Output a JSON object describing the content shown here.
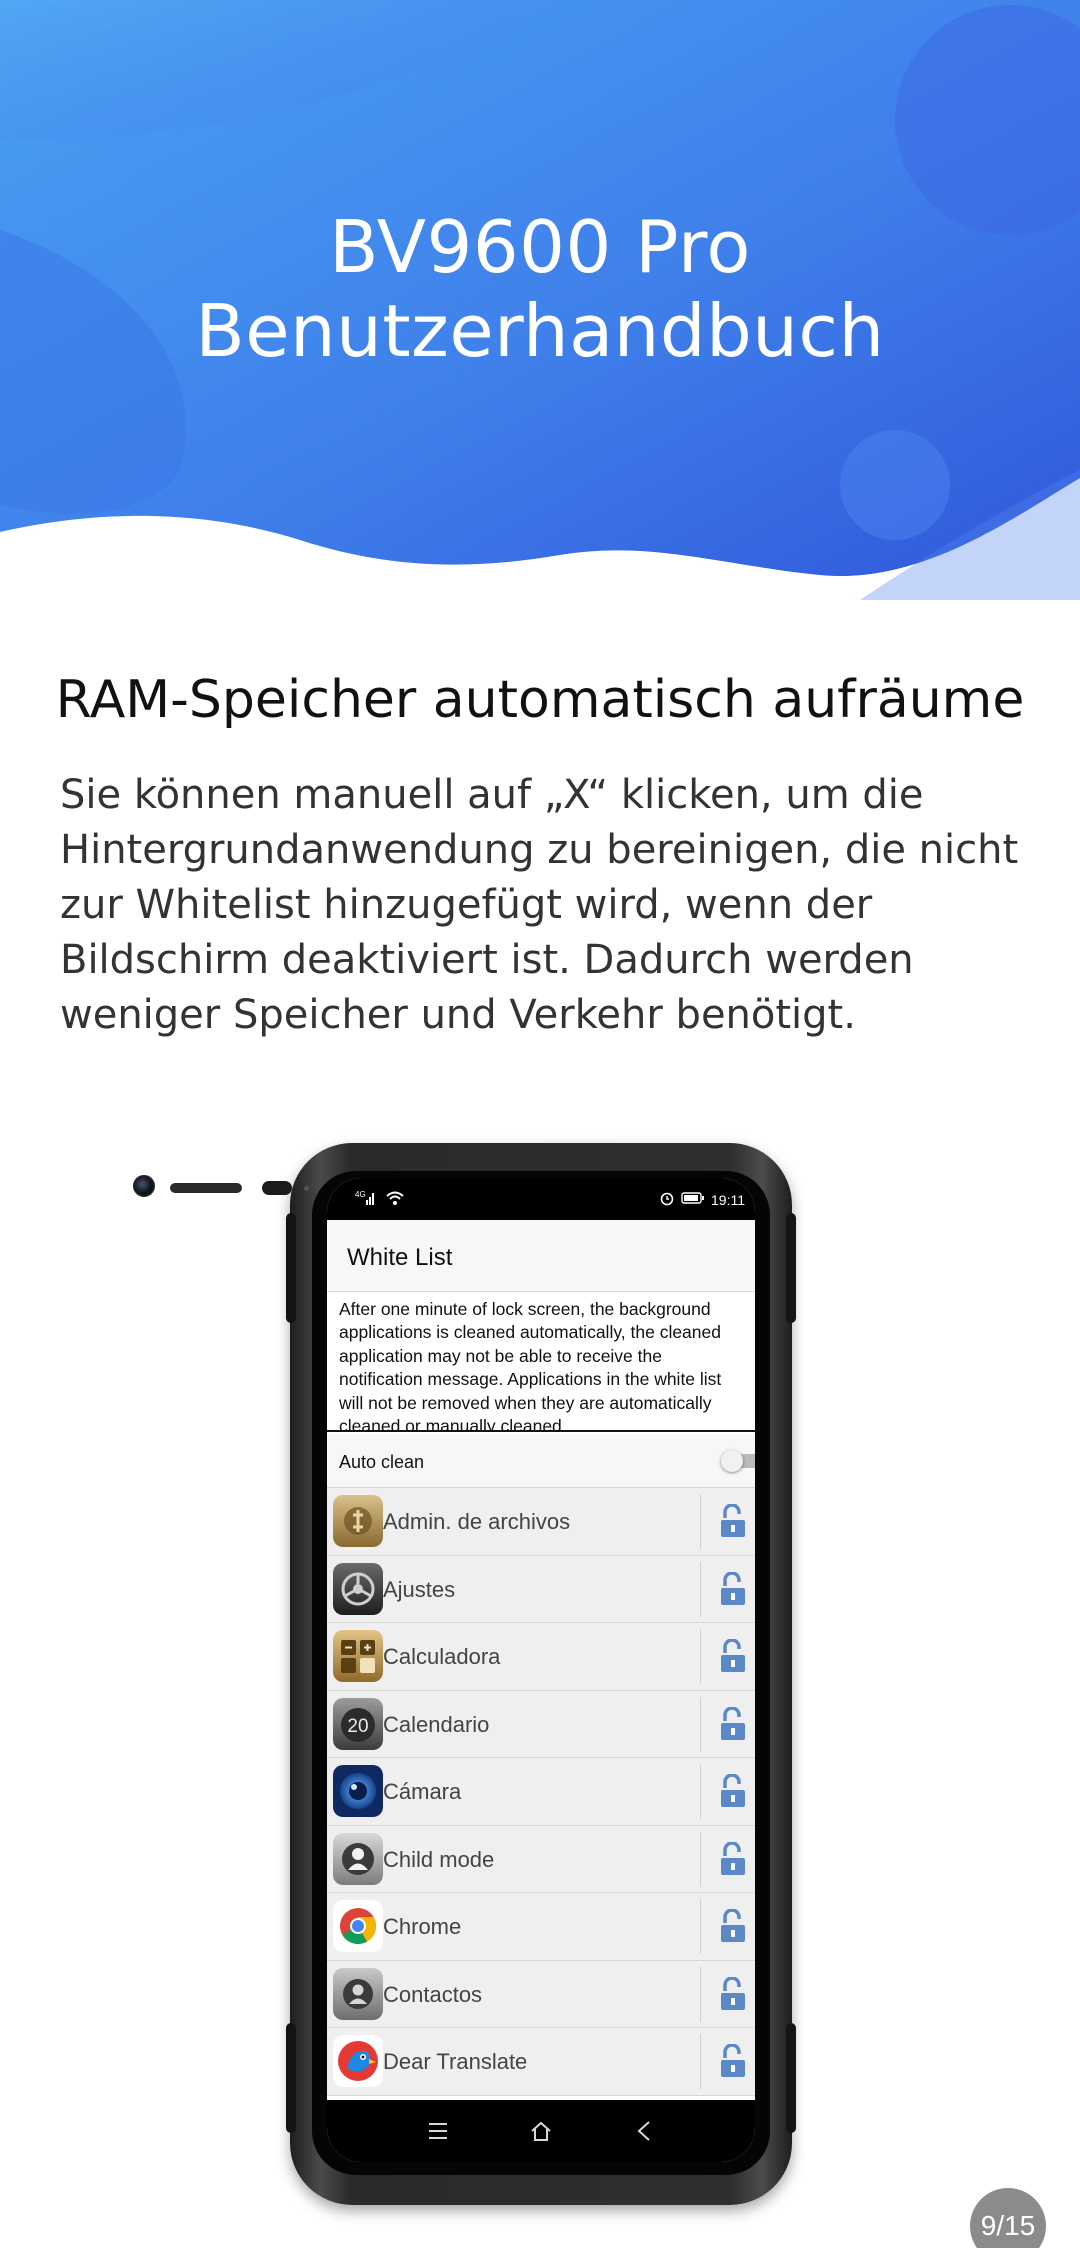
{
  "header": {
    "title": "BV9600 Pro Benutzerhandbuch",
    "colors": {
      "gradient_light": "#4a9af1",
      "gradient_dark": "#3462e2"
    }
  },
  "section": {
    "title": "RAM-Speicher automatisch aufräume",
    "body": "Sie können manuell auf „X“ klicken, um die Hintergrundanwendung zu bereinigen, die nicht zur Whitelist hinzugefügt wird, wenn der Bildschirm deaktiviert ist. Dadurch werden weniger Speicher und Verkehr benötigt."
  },
  "phone": {
    "status_bar": {
      "network": "4G",
      "time": "19:11",
      "icons": [
        "signal-icon",
        "wifi-icon",
        "alarm-icon",
        "battery-icon"
      ]
    },
    "screen_title": "White List",
    "description_lines": [
      "After one minute of lock screen, the background",
      "applications is cleaned automatically, the cleaned",
      "application may not be able to receive the",
      "notification message. Applications in the white list",
      "will not be removed when they are automatically",
      "cleaned or manually cleaned."
    ],
    "auto_clean": {
      "label": "Auto clean",
      "enabled": false
    },
    "apps": [
      {
        "name": "Admin. de archivos",
        "icon": "file-manager-icon"
      },
      {
        "name": "Ajustes",
        "icon": "settings-icon"
      },
      {
        "name": "Calculadora",
        "icon": "calculator-icon"
      },
      {
        "name": "Calendario",
        "icon": "calendar-icon",
        "icon_text": "20"
      },
      {
        "name": "Cámara",
        "icon": "camera-icon"
      },
      {
        "name": "Child mode",
        "icon": "child-mode-icon"
      },
      {
        "name": "Chrome",
        "icon": "chrome-icon"
      },
      {
        "name": "Contactos",
        "icon": "contacts-icon"
      },
      {
        "name": "Dear Translate",
        "icon": "dear-translate-icon"
      }
    ],
    "lock_state": "unlocked",
    "nav": [
      "menu-icon",
      "home-icon",
      "back-icon"
    ]
  },
  "page_indicator": "9/15"
}
